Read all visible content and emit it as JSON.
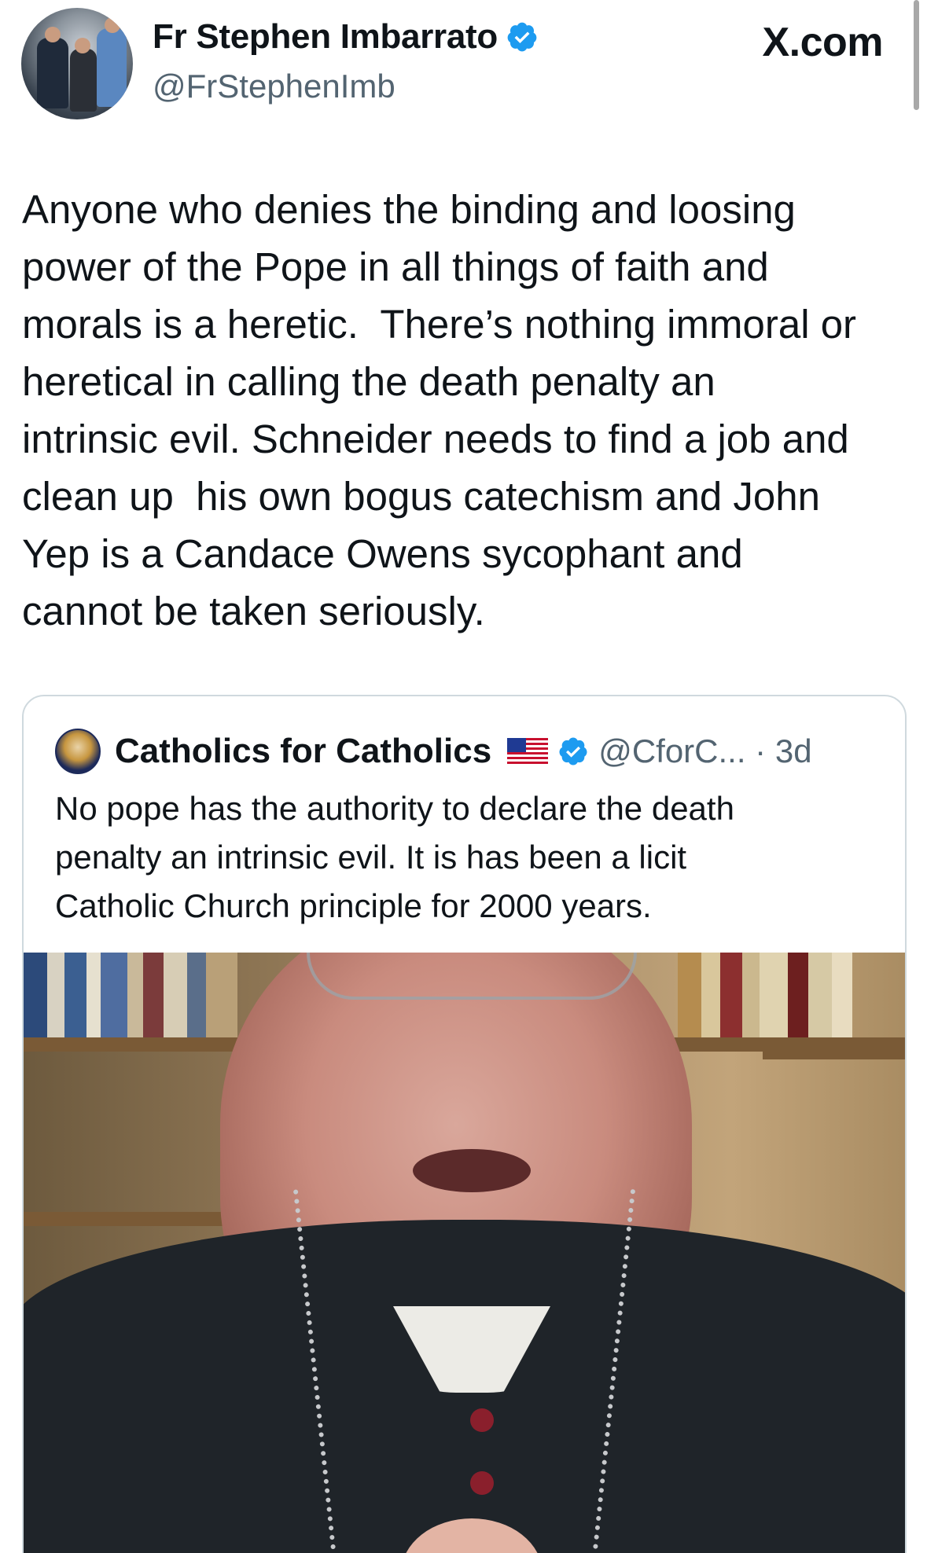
{
  "app": {
    "brand": "X.com"
  },
  "author": {
    "display_name": "Fr Stephen Imbarrato",
    "handle": "@FrStephenImb",
    "verified": true
  },
  "tweet": {
    "lines": [
      "Anyone who denies the binding and loosing",
      "power of the Pope in all things of faith and",
      "morals is a heretic.  There’s nothing immoral or",
      "heretical in calling the death penalty an",
      "intrinsic evil. Schneider needs to find a job and",
      "clean up  his own bogus catechism and John",
      "Yep is a Candace Owens sycophant and",
      "cannot be taken seriously."
    ]
  },
  "quoted_tweet": {
    "display_name": "Catholics for Catholics",
    "flag_icon": "us-flag-icon",
    "verified": true,
    "handle_time": "@CforC... · 3d",
    "lines": [
      "No pope has the authority to declare the death",
      "penalty an intrinsic evil. It is has been a licit",
      "Catholic Church principle for 2000 years."
    ],
    "media": "video-thumbnail"
  },
  "colors": {
    "text": "#0f1419",
    "secondary": "#536471",
    "verified_blue": "#1d9bf0",
    "border": "#cfd9de"
  }
}
